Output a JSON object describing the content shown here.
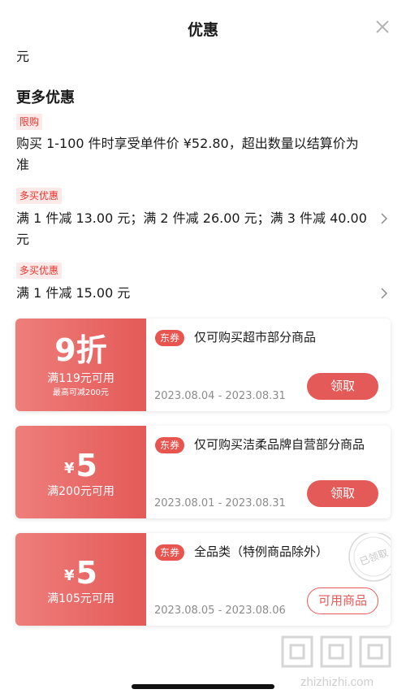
{
  "header": {
    "title": "优惠"
  },
  "cut_text": "元",
  "section_title": "更多优惠",
  "promos": [
    {
      "tag": "限购",
      "text_line1": "购买 1-100 件时享受单件价 ¥52.80，超出数量以结算价为",
      "text_line2": "准"
    },
    {
      "tag": "多买优惠",
      "text_line1": "满 1 件减 13.00 元；满 2 件减 26.00 元；满 3 件减 40.00",
      "text_line2": "元"
    },
    {
      "tag": "多买优惠",
      "text_line1": "满 1 件减 15.00 元"
    }
  ],
  "coupons": [
    {
      "amount": "9折",
      "condition": "满119元可用",
      "max": "最高可减200元",
      "tag": "东券",
      "desc": "仅可购买超市部分商品",
      "date": "2023.08.04 - 2023.08.31",
      "button": "领取"
    },
    {
      "currency": "¥",
      "amount": "5",
      "condition": "满200元可用",
      "tag": "东券",
      "desc": "仅可购买洁柔品牌自营部分商品",
      "date": "2023.08.01 - 2023.08.31",
      "button": "领取"
    },
    {
      "currency": "¥",
      "amount": "5",
      "condition": "满105元可用",
      "tag": "东券",
      "desc": "全品类（特例商品除外）",
      "date": "2023.08.05 - 2023.08.06",
      "button": "可用商品",
      "stamp": "已领取"
    }
  ],
  "watermark": "zhizhizhi.com",
  "colors": {
    "accent": "#e45a58",
    "tag_bg": "#fde9e8",
    "tag_text": "#e8332b",
    "date": "#8c8c8c"
  }
}
